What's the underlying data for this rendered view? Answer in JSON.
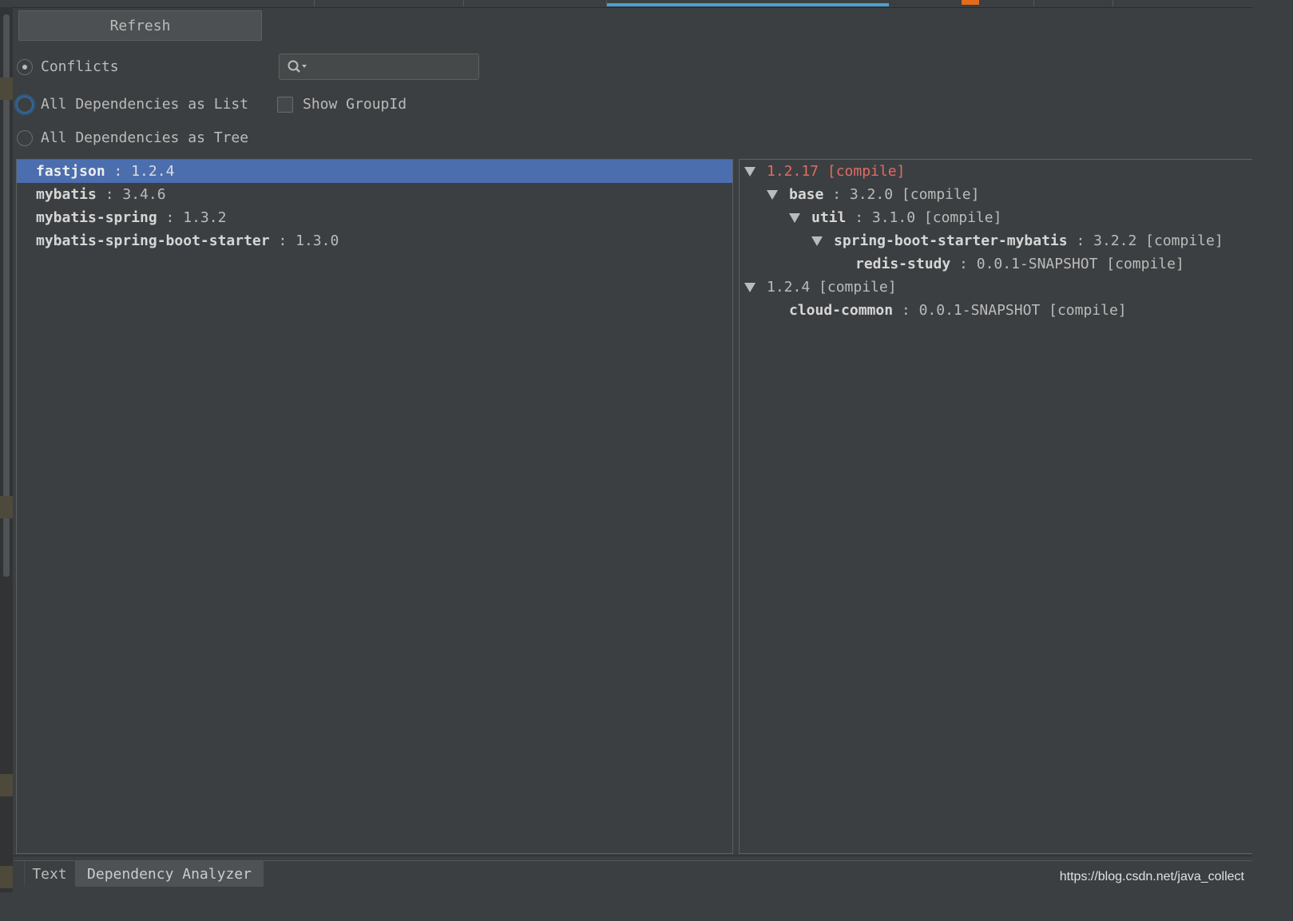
{
  "toolbar": {
    "refresh_label": "Refresh"
  },
  "options": {
    "conflicts_label": "Conflicts",
    "all_list_label": "All Dependencies as List",
    "all_tree_label": "All Dependencies as Tree",
    "show_groupid_label": "Show GroupId",
    "selected_mode": "Conflicts",
    "search_value": ""
  },
  "conflict_list": [
    {
      "name": "fastjson",
      "sep": " : ",
      "version": "1.2.4",
      "selected": true
    },
    {
      "name": "mybatis",
      "sep": " : ",
      "version": "3.4.6",
      "selected": false
    },
    {
      "name": "mybatis-spring",
      "sep": " : ",
      "version": "1.3.2",
      "selected": false
    },
    {
      "name": "mybatis-spring-boot-starter",
      "sep": " : ",
      "version": "1.3.0",
      "selected": false
    }
  ],
  "dependency_tree": {
    "node1": {
      "label": "1.2.17 [compile]",
      "color": "#e06c62"
    },
    "node1_1": {
      "name": "base",
      "sep": " : ",
      "rest": "3.2.0 [compile]"
    },
    "node1_1_1": {
      "name": "util",
      "sep": " : ",
      "rest": "3.1.0 [compile]"
    },
    "node1_1_1_1": {
      "name": "spring-boot-starter-mybatis",
      "sep": " : ",
      "rest": "3.2.2 [compile]"
    },
    "node1_1_1_1_1": {
      "name": "redis-study",
      "sep": " : ",
      "rest": "0.0.1-SNAPSHOT [compile]"
    },
    "node2": {
      "label": "1.2.4 [compile]"
    },
    "node2_1": {
      "name": "cloud-common",
      "sep": " : ",
      "rest": "0.0.1-SNAPSHOT [compile]"
    }
  },
  "bottom_tabs": {
    "text": "Text",
    "analyzer": "Dependency Analyzer"
  },
  "watermark": "https://blog.csdn.net/java_collect",
  "colors": {
    "background": "#3c3f41",
    "selection": "#4b6eaf",
    "conflict_red": "#e06c62",
    "accent_tab": "#4a9fd0"
  },
  "icons": {
    "search": "search-icon",
    "expand": "triangle-down-icon"
  }
}
